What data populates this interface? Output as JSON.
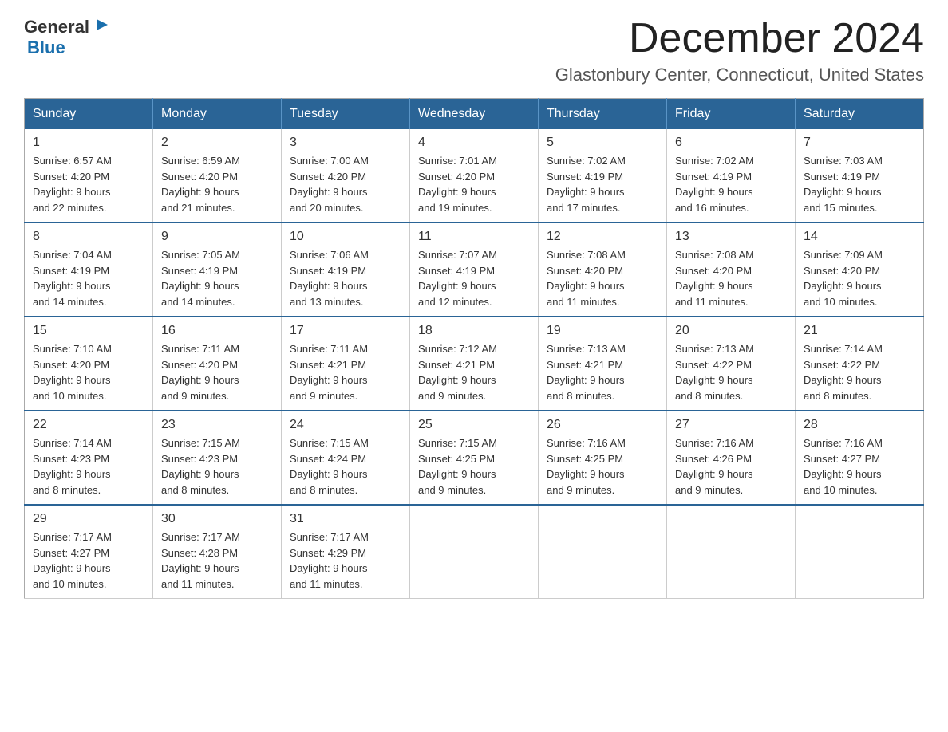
{
  "header": {
    "logo_general": "General",
    "logo_blue": "Blue",
    "month": "December 2024",
    "location": "Glastonbury Center, Connecticut, United States"
  },
  "weekdays": [
    "Sunday",
    "Monday",
    "Tuesday",
    "Wednesday",
    "Thursday",
    "Friday",
    "Saturday"
  ],
  "weeks": [
    [
      {
        "day": "1",
        "sunrise": "6:57 AM",
        "sunset": "4:20 PM",
        "daylight": "9 hours and 22 minutes."
      },
      {
        "day": "2",
        "sunrise": "6:59 AM",
        "sunset": "4:20 PM",
        "daylight": "9 hours and 21 minutes."
      },
      {
        "day": "3",
        "sunrise": "7:00 AM",
        "sunset": "4:20 PM",
        "daylight": "9 hours and 20 minutes."
      },
      {
        "day": "4",
        "sunrise": "7:01 AM",
        "sunset": "4:20 PM",
        "daylight": "9 hours and 19 minutes."
      },
      {
        "day": "5",
        "sunrise": "7:02 AM",
        "sunset": "4:19 PM",
        "daylight": "9 hours and 17 minutes."
      },
      {
        "day": "6",
        "sunrise": "7:02 AM",
        "sunset": "4:19 PM",
        "daylight": "9 hours and 16 minutes."
      },
      {
        "day": "7",
        "sunrise": "7:03 AM",
        "sunset": "4:19 PM",
        "daylight": "9 hours and 15 minutes."
      }
    ],
    [
      {
        "day": "8",
        "sunrise": "7:04 AM",
        "sunset": "4:19 PM",
        "daylight": "9 hours and 14 minutes."
      },
      {
        "day": "9",
        "sunrise": "7:05 AM",
        "sunset": "4:19 PM",
        "daylight": "9 hours and 14 minutes."
      },
      {
        "day": "10",
        "sunrise": "7:06 AM",
        "sunset": "4:19 PM",
        "daylight": "9 hours and 13 minutes."
      },
      {
        "day": "11",
        "sunrise": "7:07 AM",
        "sunset": "4:19 PM",
        "daylight": "9 hours and 12 minutes."
      },
      {
        "day": "12",
        "sunrise": "7:08 AM",
        "sunset": "4:20 PM",
        "daylight": "9 hours and 11 minutes."
      },
      {
        "day": "13",
        "sunrise": "7:08 AM",
        "sunset": "4:20 PM",
        "daylight": "9 hours and 11 minutes."
      },
      {
        "day": "14",
        "sunrise": "7:09 AM",
        "sunset": "4:20 PM",
        "daylight": "9 hours and 10 minutes."
      }
    ],
    [
      {
        "day": "15",
        "sunrise": "7:10 AM",
        "sunset": "4:20 PM",
        "daylight": "9 hours and 10 minutes."
      },
      {
        "day": "16",
        "sunrise": "7:11 AM",
        "sunset": "4:20 PM",
        "daylight": "9 hours and 9 minutes."
      },
      {
        "day": "17",
        "sunrise": "7:11 AM",
        "sunset": "4:21 PM",
        "daylight": "9 hours and 9 minutes."
      },
      {
        "day": "18",
        "sunrise": "7:12 AM",
        "sunset": "4:21 PM",
        "daylight": "9 hours and 9 minutes."
      },
      {
        "day": "19",
        "sunrise": "7:13 AM",
        "sunset": "4:21 PM",
        "daylight": "9 hours and 8 minutes."
      },
      {
        "day": "20",
        "sunrise": "7:13 AM",
        "sunset": "4:22 PM",
        "daylight": "9 hours and 8 minutes."
      },
      {
        "day": "21",
        "sunrise": "7:14 AM",
        "sunset": "4:22 PM",
        "daylight": "9 hours and 8 minutes."
      }
    ],
    [
      {
        "day": "22",
        "sunrise": "7:14 AM",
        "sunset": "4:23 PM",
        "daylight": "9 hours and 8 minutes."
      },
      {
        "day": "23",
        "sunrise": "7:15 AM",
        "sunset": "4:23 PM",
        "daylight": "9 hours and 8 minutes."
      },
      {
        "day": "24",
        "sunrise": "7:15 AM",
        "sunset": "4:24 PM",
        "daylight": "9 hours and 8 minutes."
      },
      {
        "day": "25",
        "sunrise": "7:15 AM",
        "sunset": "4:25 PM",
        "daylight": "9 hours and 9 minutes."
      },
      {
        "day": "26",
        "sunrise": "7:16 AM",
        "sunset": "4:25 PM",
        "daylight": "9 hours and 9 minutes."
      },
      {
        "day": "27",
        "sunrise": "7:16 AM",
        "sunset": "4:26 PM",
        "daylight": "9 hours and 9 minutes."
      },
      {
        "day": "28",
        "sunrise": "7:16 AM",
        "sunset": "4:27 PM",
        "daylight": "9 hours and 10 minutes."
      }
    ],
    [
      {
        "day": "29",
        "sunrise": "7:17 AM",
        "sunset": "4:27 PM",
        "daylight": "9 hours and 10 minutes."
      },
      {
        "day": "30",
        "sunrise": "7:17 AM",
        "sunset": "4:28 PM",
        "daylight": "9 hours and 11 minutes."
      },
      {
        "day": "31",
        "sunrise": "7:17 AM",
        "sunset": "4:29 PM",
        "daylight": "9 hours and 11 minutes."
      },
      null,
      null,
      null,
      null
    ]
  ],
  "labels": {
    "sunrise": "Sunrise:",
    "sunset": "Sunset:",
    "daylight": "Daylight:"
  }
}
